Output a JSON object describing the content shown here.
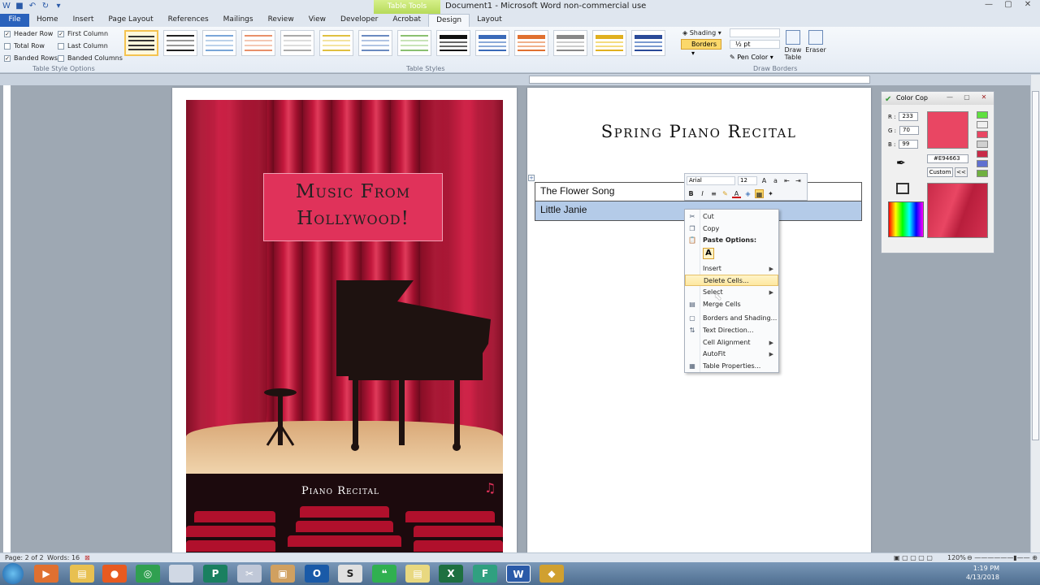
{
  "window": {
    "title": "Document1 - Microsoft Word non-commercial use",
    "contextual_tab": "Table Tools"
  },
  "tabs": [
    "File",
    "Home",
    "Insert",
    "Page Layout",
    "References",
    "Mailings",
    "Review",
    "View",
    "Developer",
    "Acrobat",
    "Design",
    "Layout"
  ],
  "ribbon": {
    "options": {
      "header_row": "Header Row",
      "total_row": "Total Row",
      "banded_rows": "Banded Rows",
      "first_column": "First Column",
      "last_column": "Last Column",
      "banded_columns": "Banded Columns",
      "group_label": "Table Style Options"
    },
    "styles_label": "Table Styles",
    "shading": "Shading",
    "borders": "Borders",
    "pt": "½ pt",
    "pen_color": "Pen Color",
    "draw_table": "Draw Table",
    "eraser": "Eraser",
    "draw_borders_label": "Draw Borders"
  },
  "poster": {
    "title_line1": "Music From",
    "title_line2": "Hollywood!",
    "subtitle": "Piano Recital"
  },
  "document": {
    "heading": "Spring Piano Recital",
    "rows": [
      "The Flower Song",
      "Little Janie"
    ]
  },
  "minitoolbar": {
    "font": "Arial",
    "size": "12"
  },
  "context_menu": {
    "cut": "Cut",
    "copy": "Copy",
    "paste_options": "Paste Options:",
    "insert": "Insert",
    "delete_cells": "Delete Cells...",
    "select": "Select",
    "merge_cells": "Merge Cells",
    "borders_shading": "Borders and Shading...",
    "text_direction": "Text Direction...",
    "cell_alignment": "Cell Alignment",
    "autofit": "AutoFit",
    "table_properties": "Table Properties..."
  },
  "colorcop": {
    "title": "Color Cop",
    "r_label": "R :",
    "r": "233",
    "g_label": "G :",
    "g": "70",
    "b_label": "B :",
    "b": "99",
    "hex": "#E94663",
    "custom": "Custom",
    "back": "<<",
    "color": "#e94663"
  },
  "status": {
    "page": "Page: 2 of 2",
    "words": "Words: 16",
    "zoom": "120%"
  },
  "tray": {
    "time": "1:19 PM",
    "date": "4/13/2018"
  }
}
